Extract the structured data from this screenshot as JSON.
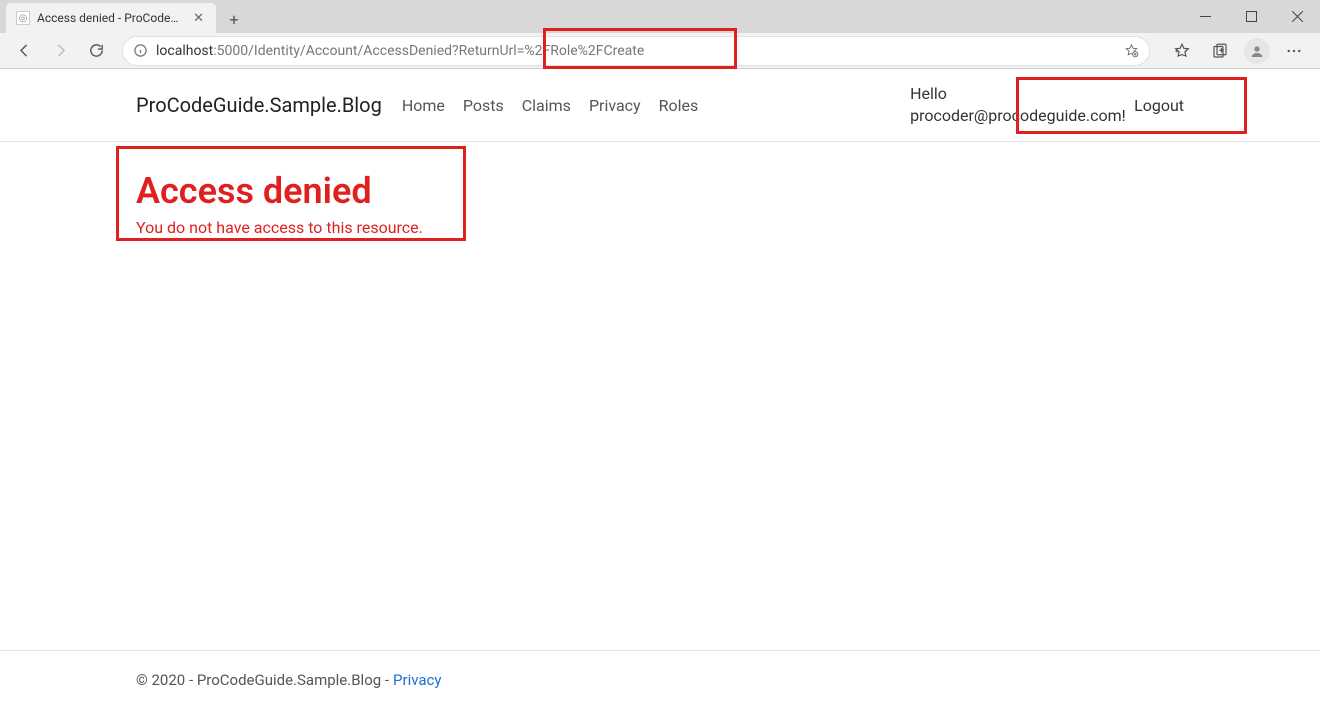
{
  "browser": {
    "tab_title": "Access denied - ProCodeGuide.S",
    "url_host": "localhost",
    "url_rest": ":5000/Identity/Account/AccessDenied?ReturnUrl=%2FRole%2FCreate"
  },
  "nav": {
    "brand": "ProCodeGuide.Sample.Blog",
    "links": [
      "Home",
      "Posts",
      "Claims",
      "Privacy",
      "Roles"
    ],
    "greeting": "Hello procoder@procodeguide.com!",
    "logout": "Logout"
  },
  "main": {
    "heading": "Access denied",
    "message": "You do not have access to this resource."
  },
  "footer": {
    "copyright": "© 2020 - ProCodeGuide.Sample.Blog - ",
    "privacy": "Privacy"
  },
  "highlight_color": "#e01f1f"
}
